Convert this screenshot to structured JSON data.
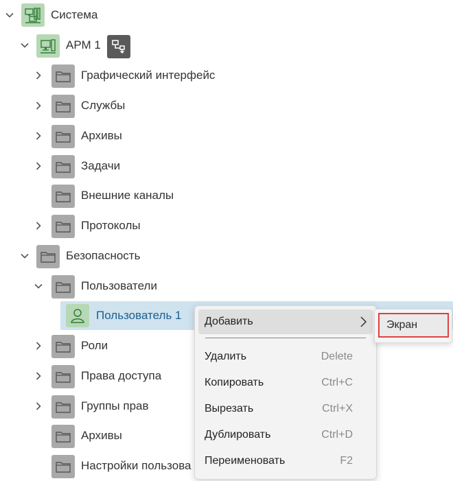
{
  "tree": {
    "root": {
      "label": "Система",
      "icon": "system-icon"
    },
    "arm": {
      "label": "АРМ 1",
      "icon": "workstation-icon",
      "badge_icon": "move-down-icon"
    },
    "arm_children": [
      {
        "label": "Графический интерфейс",
        "expandable": true
      },
      {
        "label": "Службы",
        "expandable": true
      },
      {
        "label": "Архивы",
        "expandable": true
      },
      {
        "label": "Задачи",
        "expandable": true
      },
      {
        "label": "Внешние каналы",
        "expandable": false
      },
      {
        "label": "Протоколы",
        "expandable": true
      }
    ],
    "security": {
      "label": "Безопасность"
    },
    "users_folder": {
      "label": "Пользователи"
    },
    "selected_user": {
      "label": "Пользователь 1",
      "icon": "user-icon"
    },
    "security_children": [
      {
        "label": "Роли",
        "expandable": true
      },
      {
        "label": "Права доступа",
        "expandable": true
      },
      {
        "label": "Группы прав",
        "expandable": true
      },
      {
        "label": "Архивы",
        "expandable": false
      },
      {
        "label": "Настройки пользова",
        "expandable": false
      }
    ]
  },
  "context_menu": {
    "add": {
      "label": "Добавить"
    },
    "items": [
      {
        "label": "Удалить",
        "shortcut": "Delete"
      },
      {
        "label": "Копировать",
        "shortcut": "Ctrl+C"
      },
      {
        "label": "Вырезать",
        "shortcut": "Ctrl+X"
      },
      {
        "label": "Дублировать",
        "shortcut": "Ctrl+D"
      },
      {
        "label": "Переименовать",
        "shortcut": "F2"
      }
    ],
    "submenu": {
      "item": "Экран"
    }
  },
  "colors": {
    "selection": "#cfe3ef",
    "folder_icon_bg": "#a9a9a9",
    "system_icon_bg": "#b7d8b4",
    "highlight_border": "#e04040"
  }
}
